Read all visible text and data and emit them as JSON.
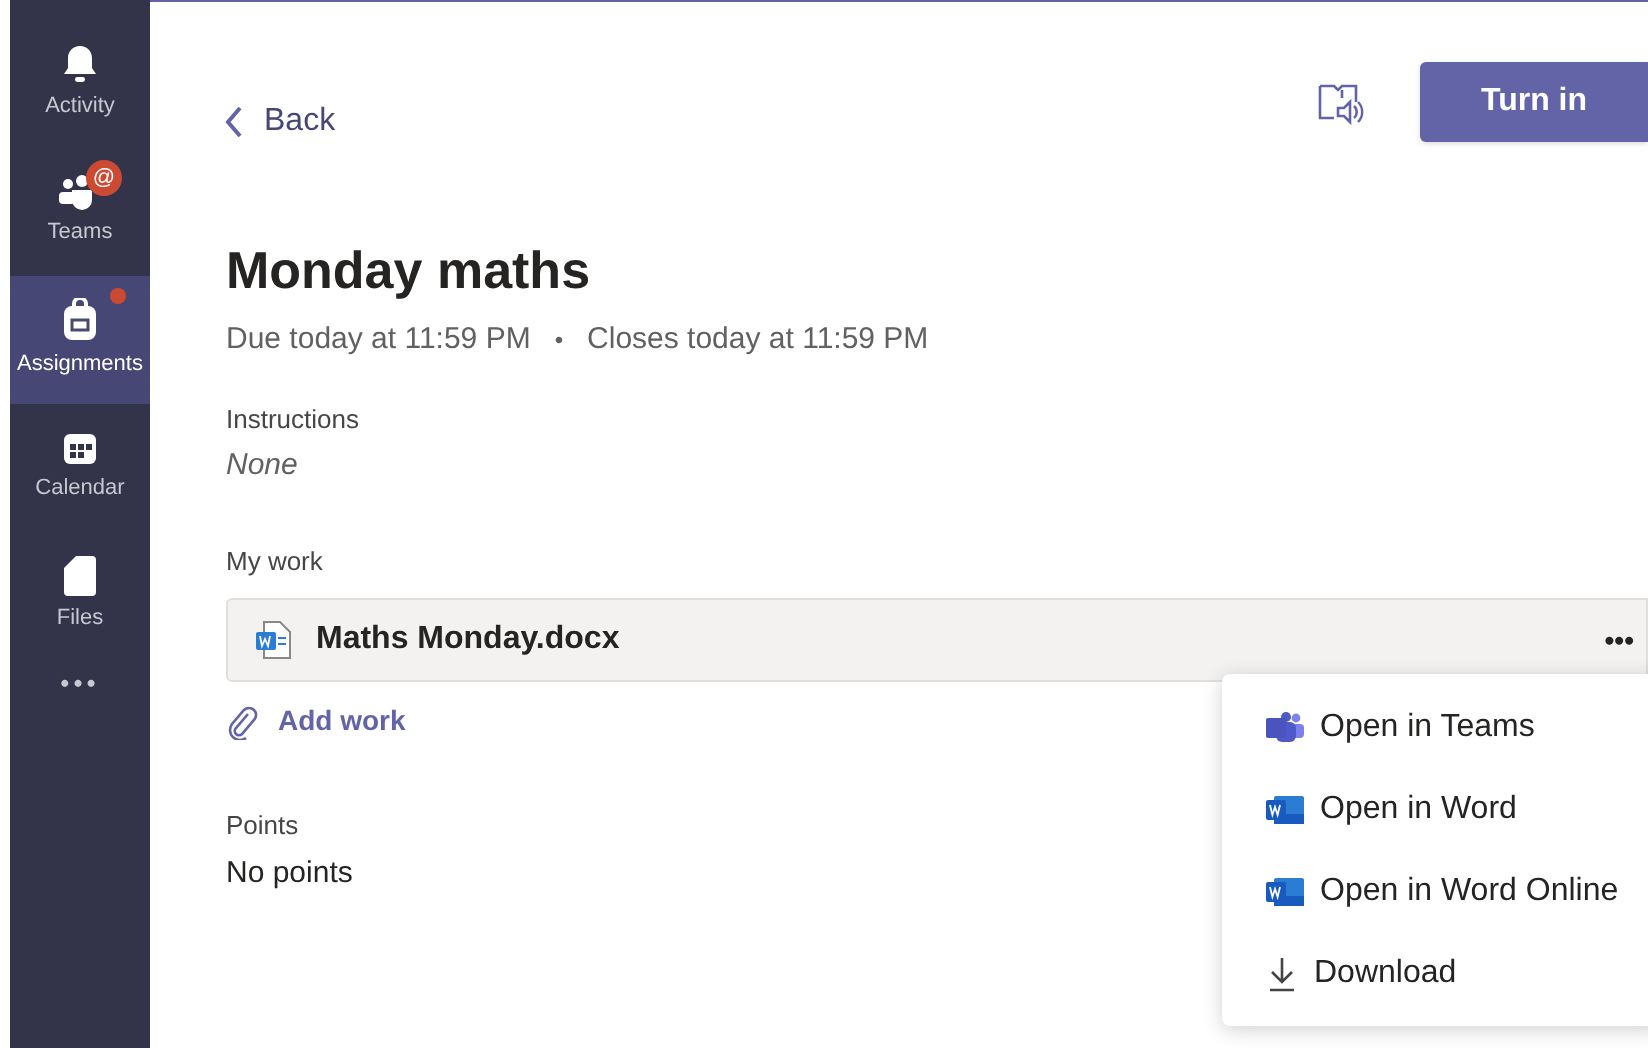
{
  "sidebar": {
    "items": [
      {
        "label": "Activity",
        "kind": "bell",
        "selected": false
      },
      {
        "label": "Teams",
        "kind": "teams",
        "selected": false,
        "badge": "@"
      },
      {
        "label": "Assignments",
        "kind": "bag",
        "selected": true,
        "dot": true
      },
      {
        "label": "Calendar",
        "kind": "calendar",
        "selected": false
      },
      {
        "label": "Files",
        "kind": "file",
        "selected": false
      }
    ],
    "more": "•••"
  },
  "header": {
    "back": "Back",
    "turn_in": "Turn in"
  },
  "assignment": {
    "title": "Monday maths",
    "due": "Due today at 11:59 PM",
    "separator": "•",
    "closes": "Closes today at 11:59 PM",
    "instructions_label": "Instructions",
    "instructions": "None",
    "my_work_label": "My work",
    "file": "Maths Monday.docx",
    "file_more": "•••",
    "add_work": "Add work",
    "points_label": "Points",
    "points": "No points"
  },
  "menu": {
    "items": [
      {
        "label": "Open in Teams",
        "kind": "teams"
      },
      {
        "label": "Open in Word",
        "kind": "word"
      },
      {
        "label": "Open in Word Online",
        "kind": "word"
      },
      {
        "label": "Download",
        "kind": "download"
      }
    ]
  }
}
